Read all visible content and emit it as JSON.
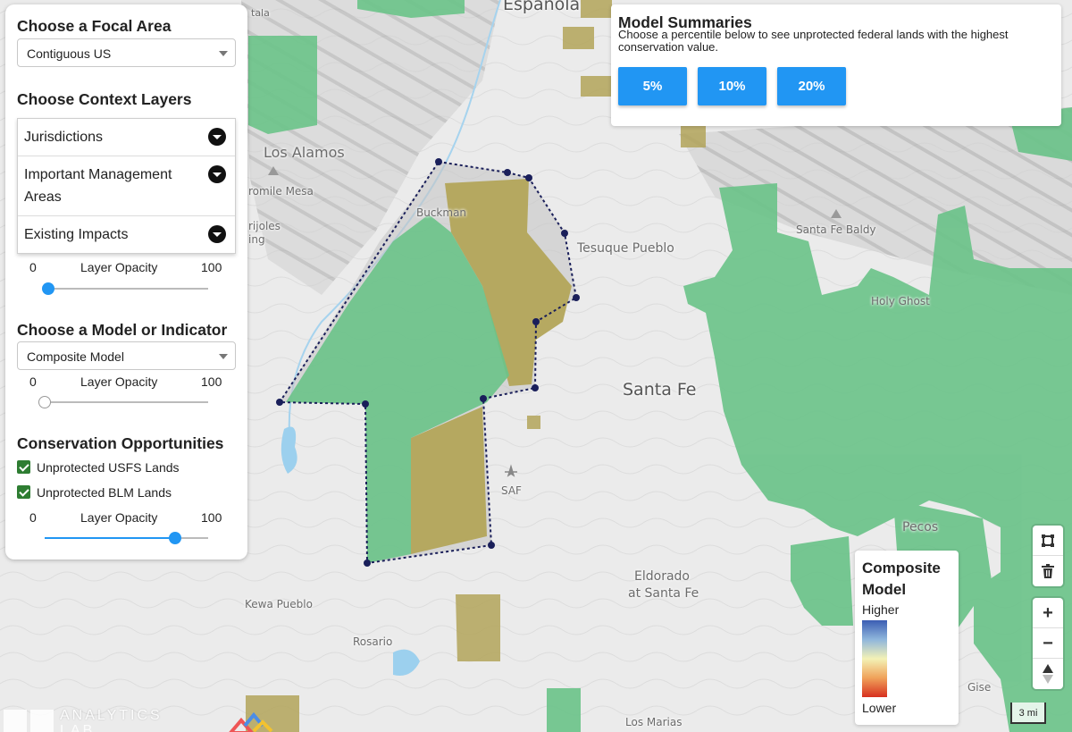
{
  "focal_area": {
    "title": "Choose a Focal Area",
    "selected": "Contiguous US"
  },
  "context_layers": {
    "title": "Choose Context Layers",
    "items": [
      {
        "label": "Jurisdictions"
      },
      {
        "label": "Important Management Areas"
      },
      {
        "label": "Existing Impacts"
      }
    ],
    "opacity": {
      "min": "0",
      "label": "Layer Opacity",
      "max": "100",
      "value": 0.02
    }
  },
  "model": {
    "title": "Choose a Model or Indicator",
    "selected": "Composite Model",
    "opacity": {
      "min": "0",
      "label": "Layer Opacity",
      "max": "100",
      "value": 0
    }
  },
  "conservation": {
    "title": "Conservation Opportunities",
    "checkboxes": [
      {
        "label": "Unprotected USFS Lands",
        "checked": true
      },
      {
        "label": "Unprotected BLM Lands",
        "checked": true
      }
    ],
    "opacity": {
      "min": "0",
      "label": "Layer Opacity",
      "max": "100",
      "value": 0.8
    }
  },
  "summaries": {
    "title": "Model Summaries",
    "description": "Choose a percentile below to see unprotected federal lands with the highest conservation value.",
    "buttons": [
      "5%",
      "10%",
      "20%"
    ]
  },
  "legend": {
    "title": "Composite Model",
    "high": "Higher",
    "low": "Lower"
  },
  "map_labels": {
    "espanola": "Espanola",
    "los_alamos": "Los Alamos",
    "white_rock": "romile Mesa",
    "frijoles": "rijoles",
    "frijoles2": "ing",
    "buckman": "Buckman",
    "tesuque": "Tesuque Pueblo",
    "santa_fe_baldy": "Santa Fe Baldy",
    "holy_ghost": "Holy Ghost",
    "santa_fe": "Santa Fe",
    "saf": "SAF",
    "pecos": "Pecos",
    "eldorado": "Eldorado",
    "eldorado2": "at Santa Fe",
    "kewa": "Kewa Pueblo",
    "rosario": "Rosario",
    "los_marias": "Los Marias",
    "glorieta": "Gise",
    "top_left": "tala"
  },
  "controls": {
    "zoom_in": "+",
    "zoom_out": "−",
    "scale": "3 mi"
  },
  "logo": {
    "line1": "ANALYTICS",
    "line2": "LAB"
  },
  "colors": {
    "usfs": "#6cc38a",
    "blm": "#b3a55a",
    "accent": "#2196f3",
    "polygon_stroke": "#1a1f5a"
  }
}
